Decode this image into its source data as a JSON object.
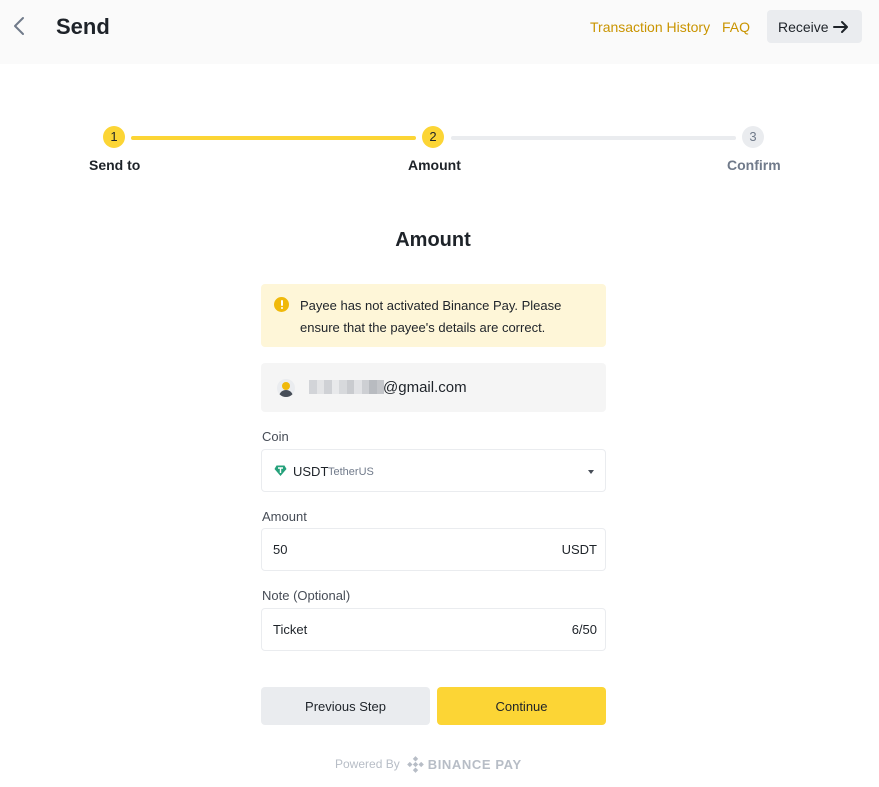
{
  "header": {
    "back_icon": "chevron-left-icon",
    "title": "Send",
    "transaction_history": "Transaction History",
    "faq": "FAQ",
    "receive_label": "Receive",
    "receive_icon": "arrow-right-icon"
  },
  "stepper": {
    "current_step": 2,
    "steps": [
      {
        "number": "1",
        "label": "Send to"
      },
      {
        "number": "2",
        "label": "Amount"
      },
      {
        "number": "3",
        "label": "Confirm"
      }
    ]
  },
  "form": {
    "heading": "Amount",
    "warning": {
      "icon": "exclamation-icon",
      "text": "Payee has not activated Binance Pay. Please ensure that the payee's details are correct."
    },
    "payee": {
      "avatar_icon": "user-avatar-icon",
      "email": "@gmail.com"
    },
    "coin": {
      "label": "Coin",
      "symbol": "USDT",
      "name": "TetherUS",
      "icon": "tether-icon"
    },
    "amount": {
      "label": "Amount",
      "value": "50",
      "unit": "USDT"
    },
    "note": {
      "label": "Note (Optional)",
      "value": "Ticket",
      "counter": "6/50"
    },
    "prev_button": "Previous Step",
    "continue_button": "Continue"
  },
  "footer": {
    "powered_by": "Powered By",
    "brand": "BINANCE PAY",
    "logo_icon": "binance-logo-icon"
  },
  "colors": {
    "accent": "#fcd535",
    "link": "#c99400",
    "warning_bg": "#fef6d8",
    "muted": "#707a8a"
  }
}
